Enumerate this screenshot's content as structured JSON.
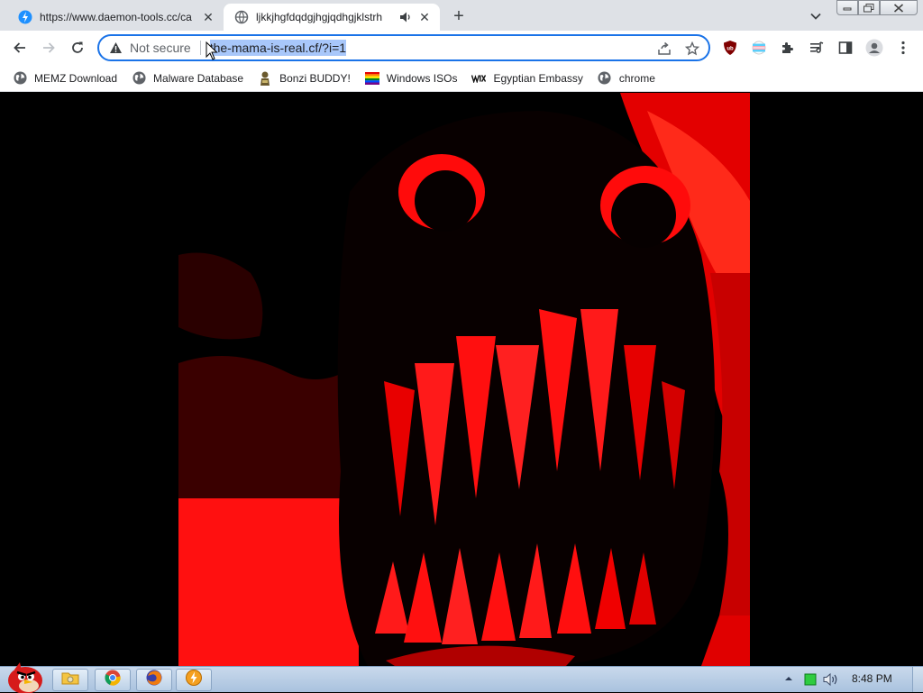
{
  "tabs": [
    {
      "title": "https://www.daemon-tools.cc/ca",
      "active": false,
      "icon": "daemon-tools-icon"
    },
    {
      "title": "ljkkjhgfdqdgjhgjqdhgjklstrh",
      "active": true,
      "icon": "globe-icon",
      "audio": true
    }
  ],
  "toolbar": {
    "security_text": "Not secure",
    "url": "the-mama-is-real.cf/?i=1"
  },
  "bookmarks": [
    {
      "label": "MEMZ Download",
      "icon": "globe-icon"
    },
    {
      "label": "Malware Database",
      "icon": "globe-icon"
    },
    {
      "label": "Bonzi BUDDY!",
      "icon": "bonzi-icon"
    },
    {
      "label": "Windows ISOs",
      "icon": "rainbow-flag-icon"
    },
    {
      "label": "Egyptian Embassy",
      "icon": "wix-icon"
    },
    {
      "label": "chrome",
      "icon": "globe-icon"
    }
  ],
  "taskbar": {
    "clock": "8:48 PM",
    "apps": [
      "explorer-icon",
      "chrome-icon",
      "firefox-icon",
      "daemon-tools-icon"
    ]
  },
  "colors": {
    "accent": "#1a73e8",
    "page_bg": "#000000",
    "image_red": "#ff0000"
  }
}
